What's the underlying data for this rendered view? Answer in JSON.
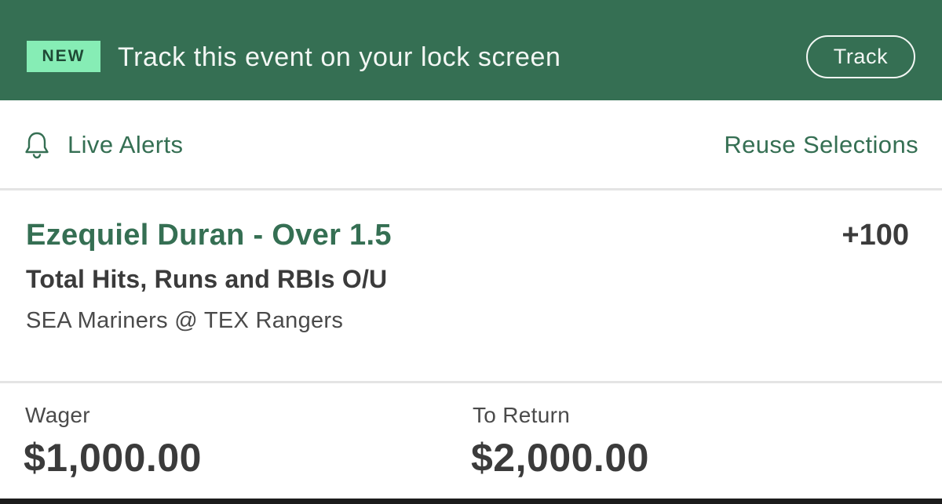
{
  "banner": {
    "badge": "NEW",
    "text": "Track this event on your lock screen",
    "track_label": "Track",
    "background_color": "#356f53",
    "badge_color": "#86edb5"
  },
  "alerts": {
    "live_alerts_label": "Live Alerts",
    "live_alerts_icon": "bell-icon",
    "reuse_label": "Reuse Selections"
  },
  "selection": {
    "name": "Ezequiel Duran - Over 1.5",
    "odds": "+100",
    "market": "Total Hits, Runs and RBIs O/U",
    "event": "SEA Mariners @ TEX Rangers"
  },
  "wager": {
    "label": "Wager",
    "amount": "$1,000.00"
  },
  "return": {
    "label": "To Return",
    "amount": "$2,000.00"
  },
  "colors": {
    "accent": "#356f53",
    "text_dark": "#3b3b3b"
  }
}
